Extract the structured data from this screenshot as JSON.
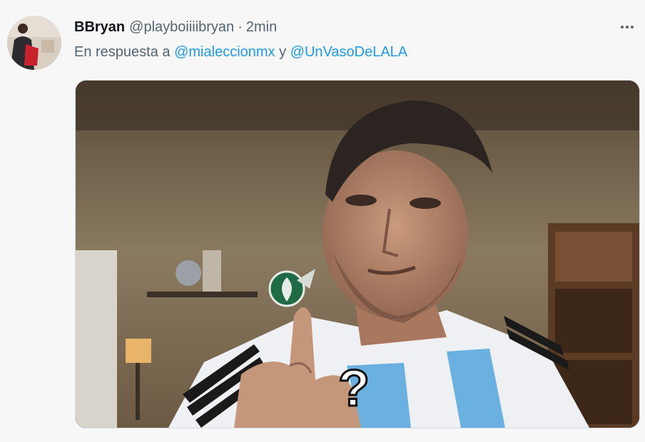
{
  "tweet": {
    "display_name": "BBryan",
    "handle": "@playboiiiibryan",
    "separator": "·",
    "timestamp": "2min",
    "reply_prefix": "En respuesta a",
    "reply_mention_1": "@mialeccionmx",
    "reply_conjunction": "y",
    "reply_mention_2": "@UnVasoDeLALA",
    "media_overlay_text": "?"
  },
  "icons": {
    "more": "more-horizontal-icon",
    "badge": "mexico-team-crest-icon"
  },
  "colors": {
    "link": "#1d9bf0",
    "secondary_text": "#536471",
    "primary_text": "#0f1419"
  }
}
